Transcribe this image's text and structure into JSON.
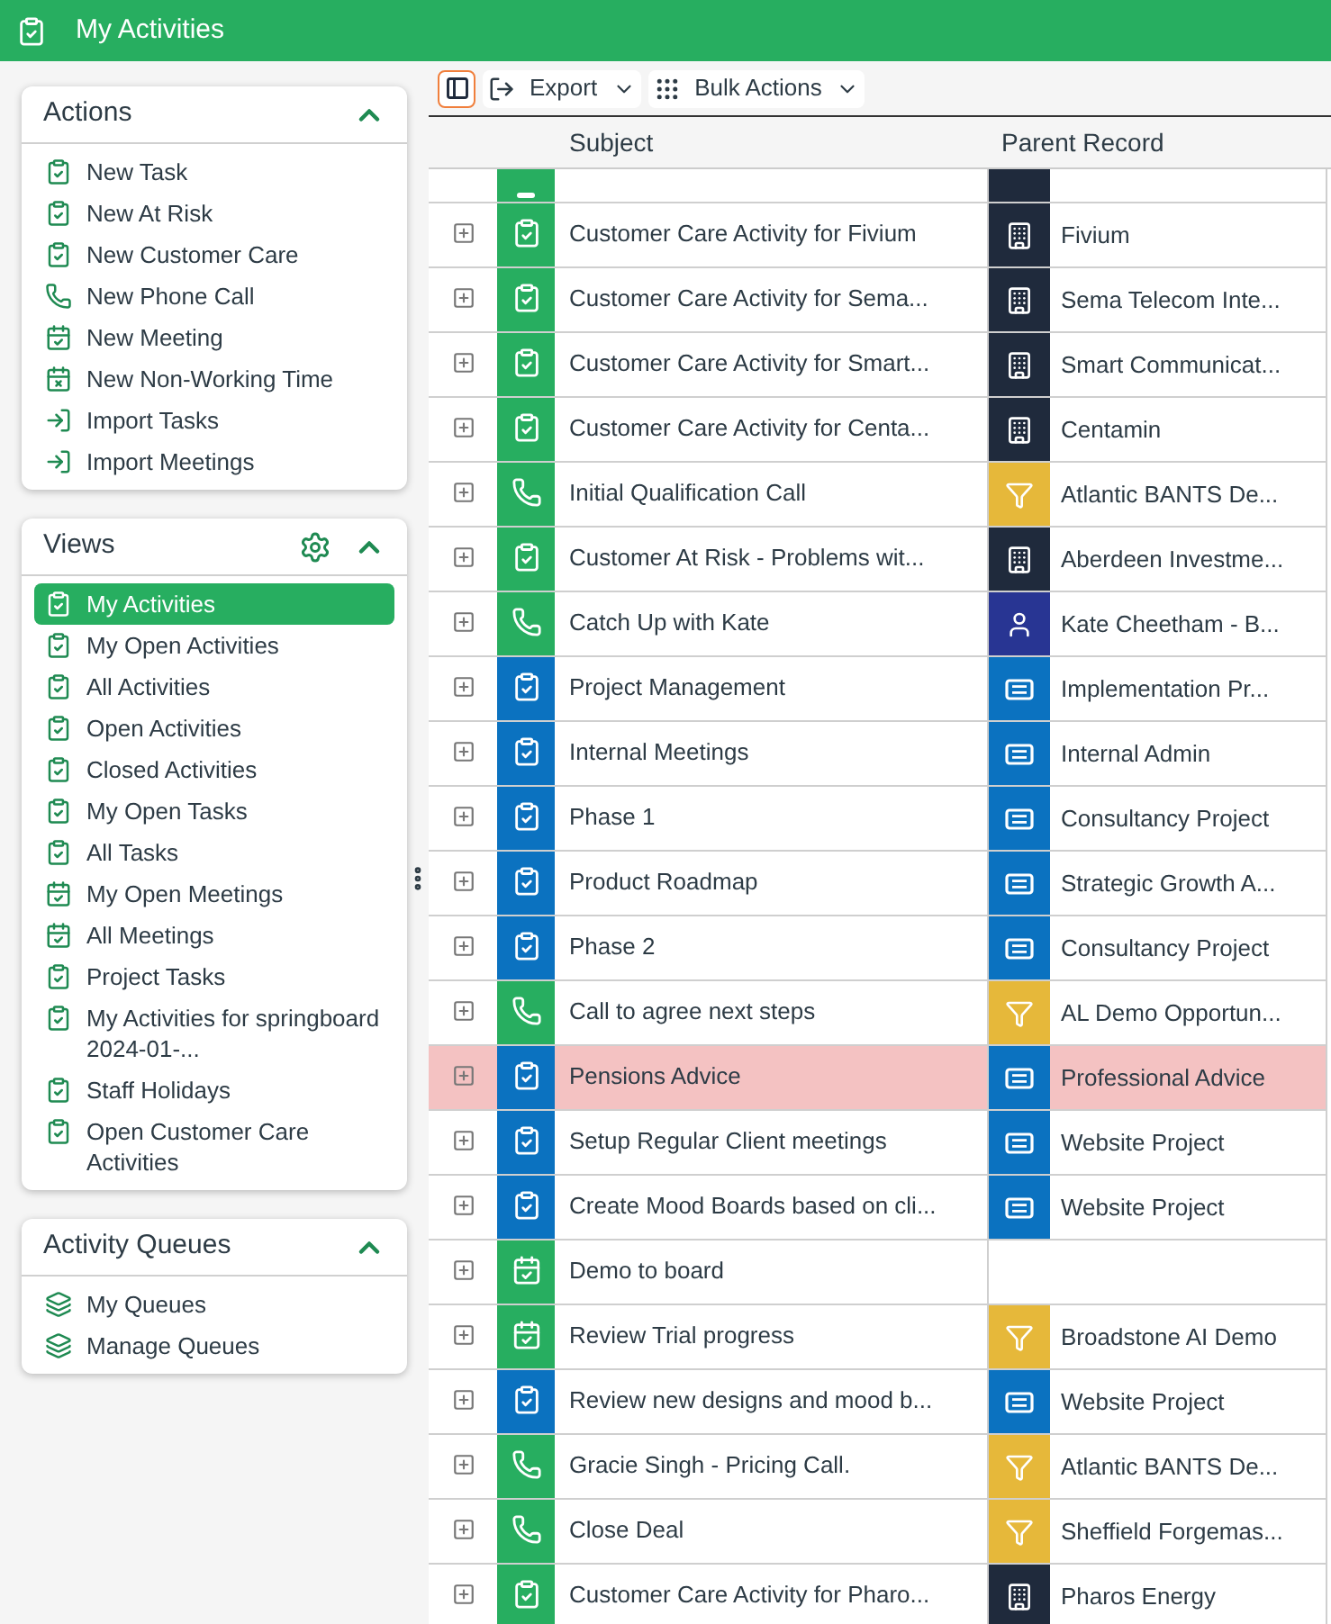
{
  "header": {
    "title": "My Activities"
  },
  "sidebar": {
    "actions": {
      "title": "Actions",
      "expanded": true,
      "items": [
        {
          "label": "New Task",
          "kind": "task"
        },
        {
          "label": "New At Risk",
          "kind": "task"
        },
        {
          "label": "New Customer Care",
          "kind": "task"
        },
        {
          "label": "New Phone Call",
          "kind": "phone"
        },
        {
          "label": "New Meeting",
          "kind": "meeting"
        },
        {
          "label": "New Non-Working Time",
          "kind": "nonworking"
        },
        {
          "label": "Import Tasks",
          "kind": "import"
        },
        {
          "label": "Import Meetings",
          "kind": "import"
        }
      ]
    },
    "views": {
      "title": "Views",
      "expanded": true,
      "items": [
        {
          "label": "My Activities",
          "kind": "task",
          "selected": true
        },
        {
          "label": "My Open Activities",
          "kind": "task",
          "selected": false
        },
        {
          "label": "All Activities",
          "kind": "task",
          "selected": false
        },
        {
          "label": "Open Activities",
          "kind": "task",
          "selected": false
        },
        {
          "label": "Closed Activities",
          "kind": "task",
          "selected": false
        },
        {
          "label": "My Open Tasks",
          "kind": "task",
          "selected": false
        },
        {
          "label": "All Tasks",
          "kind": "task",
          "selected": false
        },
        {
          "label": "My Open Meetings",
          "kind": "meeting",
          "selected": false
        },
        {
          "label": "All Meetings",
          "kind": "meeting",
          "selected": false
        },
        {
          "label": "Project Tasks",
          "kind": "task",
          "selected": false
        },
        {
          "label": "My Activities for springboard 2024-01-...",
          "kind": "task",
          "selected": false
        },
        {
          "label": "Staff Holidays",
          "kind": "task",
          "selected": false
        },
        {
          "label": "Open Customer Care Activities",
          "kind": "task",
          "selected": false
        }
      ]
    },
    "queues": {
      "title": "Activity Queues",
      "expanded": true,
      "items": [
        {
          "label": "My Queues",
          "kind": "queue"
        },
        {
          "label": "Manage Queues",
          "kind": "queue"
        }
      ]
    }
  },
  "toolbar": {
    "buttons": [
      {
        "label": "Export",
        "kind": "export"
      },
      {
        "label": "Bulk Actions",
        "kind": "bulk"
      }
    ]
  },
  "table": {
    "columns": [
      "Subject",
      "Parent Record"
    ],
    "rows": [
      {
        "kind": "task",
        "color": "#27ae60",
        "highlighted": false,
        "partial": true,
        "parent": {
          "kind": "account"
        }
      },
      {
        "subject": "Customer Care Activity for Fivium",
        "kind": "task",
        "color": "#27ae60",
        "highlighted": false,
        "parent": {
          "label": "Fivium",
          "kind": "account"
        }
      },
      {
        "subject": "Customer Care Activity for Sema...",
        "kind": "task",
        "color": "#27ae60",
        "highlighted": false,
        "parent": {
          "label": "Sema Telecom Inte...",
          "kind": "account"
        }
      },
      {
        "subject": "Customer Care Activity for Smart...",
        "kind": "task",
        "color": "#27ae60",
        "highlighted": false,
        "parent": {
          "label": "Smart Communicat...",
          "kind": "account"
        }
      },
      {
        "subject": "Customer Care Activity for Centa...",
        "kind": "task",
        "color": "#27ae60",
        "highlighted": false,
        "parent": {
          "label": "Centamin",
          "kind": "account"
        }
      },
      {
        "subject": "Initial Qualification Call",
        "kind": "phone",
        "color": "#27ae60",
        "highlighted": false,
        "parent": {
          "label": "Atlantic BANTS De...",
          "kind": "lead"
        }
      },
      {
        "subject": "Customer At Risk - Problems wit...",
        "kind": "task",
        "color": "#27ae60",
        "highlighted": false,
        "parent": {
          "label": "Aberdeen Investme...",
          "kind": "account"
        }
      },
      {
        "subject": "Catch Up with Kate",
        "kind": "phone",
        "color": "#27ae60",
        "highlighted": false,
        "parent": {
          "label": "Kate Cheetham - B...",
          "kind": "contact"
        }
      },
      {
        "subject": "Project Management",
        "kind": "task",
        "color": "#0b72c0",
        "highlighted": false,
        "parent": {
          "label": "Implementation Pr...",
          "kind": "project"
        }
      },
      {
        "subject": "Internal Meetings",
        "kind": "task",
        "color": "#0b72c0",
        "highlighted": false,
        "parent": {
          "label": "Internal Admin",
          "kind": "project"
        }
      },
      {
        "subject": "Phase 1",
        "kind": "task",
        "color": "#0b72c0",
        "highlighted": false,
        "parent": {
          "label": "Consultancy Project",
          "kind": "project"
        }
      },
      {
        "subject": "Product Roadmap",
        "kind": "task",
        "color": "#0b72c0",
        "highlighted": false,
        "parent": {
          "label": "Strategic Growth A...",
          "kind": "project"
        }
      },
      {
        "subject": "Phase 2",
        "kind": "task",
        "color": "#0b72c0",
        "highlighted": false,
        "parent": {
          "label": "Consultancy Project",
          "kind": "project"
        }
      },
      {
        "subject": "Call to agree next steps",
        "kind": "phone",
        "color": "#27ae60",
        "highlighted": false,
        "parent": {
          "label": "AL Demo Opportun...",
          "kind": "lead"
        }
      },
      {
        "subject": "Pensions Advice",
        "kind": "task",
        "color": "#0b72c0",
        "highlighted": true,
        "parent": {
          "label": "Professional Advice",
          "kind": "project"
        }
      },
      {
        "subject": "Setup Regular Client meetings",
        "kind": "task",
        "color": "#0b72c0",
        "highlighted": false,
        "parent": {
          "label": "Website Project",
          "kind": "project"
        }
      },
      {
        "subject": "Create Mood Boards based on cli...",
        "kind": "task",
        "color": "#0b72c0",
        "highlighted": false,
        "parent": {
          "label": "Website Project",
          "kind": "project"
        }
      },
      {
        "subject": "Demo to board",
        "kind": "meeting",
        "color": "#27ae60",
        "highlighted": false
      },
      {
        "subject": "Review Trial progress",
        "kind": "meeting",
        "color": "#27ae60",
        "highlighted": false,
        "parent": {
          "label": "Broadstone AI Demo",
          "kind": "lead"
        }
      },
      {
        "subject": "Review new designs and mood b...",
        "kind": "task",
        "color": "#0b72c0",
        "highlighted": false,
        "parent": {
          "label": "Website Project",
          "kind": "project"
        }
      },
      {
        "subject": "Gracie Singh - Pricing Call.",
        "kind": "phone",
        "color": "#27ae60",
        "highlighted": false,
        "parent": {
          "label": "Atlantic BANTS De...",
          "kind": "lead"
        }
      },
      {
        "subject": "Close Deal",
        "kind": "phone",
        "color": "#27ae60",
        "highlighted": false,
        "parent": {
          "label": "Sheffield Forgemas...",
          "kind": "lead"
        }
      },
      {
        "subject": "Customer Care Activity for Pharo...",
        "kind": "task",
        "color": "#27ae60",
        "highlighted": false,
        "parent": {
          "label": "Pharos Energy",
          "kind": "account"
        }
      }
    ]
  }
}
